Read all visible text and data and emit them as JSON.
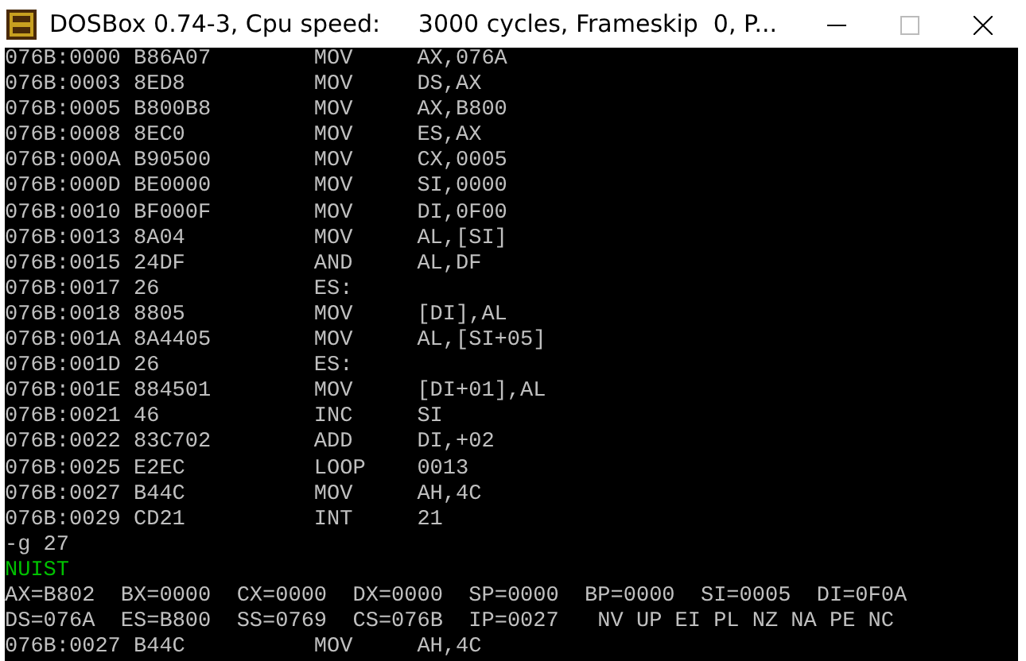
{
  "window": {
    "title": "DOSBox 0.74-3, Cpu speed:     3000 cycles, Frameskip  0, P..."
  },
  "console": {
    "lines": [
      {
        "kind": "asm",
        "address": "076B:0000",
        "bytes": "B86A07",
        "mnemonic": "MOV",
        "operands": "AX,076A"
      },
      {
        "kind": "asm",
        "address": "076B:0003",
        "bytes": "8ED8",
        "mnemonic": "MOV",
        "operands": "DS,AX"
      },
      {
        "kind": "asm",
        "address": "076B:0005",
        "bytes": "B800B8",
        "mnemonic": "MOV",
        "operands": "AX,B800"
      },
      {
        "kind": "asm",
        "address": "076B:0008",
        "bytes": "8EC0",
        "mnemonic": "MOV",
        "operands": "ES,AX"
      },
      {
        "kind": "asm",
        "address": "076B:000A",
        "bytes": "B90500",
        "mnemonic": "MOV",
        "operands": "CX,0005"
      },
      {
        "kind": "asm",
        "address": "076B:000D",
        "bytes": "BE0000",
        "mnemonic": "MOV",
        "operands": "SI,0000"
      },
      {
        "kind": "asm",
        "address": "076B:0010",
        "bytes": "BF000F",
        "mnemonic": "MOV",
        "operands": "DI,0F00"
      },
      {
        "kind": "asm",
        "address": "076B:0013",
        "bytes": "8A04",
        "mnemonic": "MOV",
        "operands": "AL,[SI]"
      },
      {
        "kind": "asm",
        "address": "076B:0015",
        "bytes": "24DF",
        "mnemonic": "AND",
        "operands": "AL,DF"
      },
      {
        "kind": "asm",
        "address": "076B:0017",
        "bytes": "26",
        "mnemonic": "ES:"
      },
      {
        "kind": "asm",
        "address": "076B:0018",
        "bytes": "8805",
        "mnemonic": "MOV",
        "operands": "[DI],AL"
      },
      {
        "kind": "asm",
        "address": "076B:001A",
        "bytes": "8A4405",
        "mnemonic": "MOV",
        "operands": "AL,[SI+05]"
      },
      {
        "kind": "asm",
        "address": "076B:001D",
        "bytes": "26",
        "mnemonic": "ES:"
      },
      {
        "kind": "asm",
        "address": "076B:001E",
        "bytes": "884501",
        "mnemonic": "MOV",
        "operands": "[DI+01],AL"
      },
      {
        "kind": "asm",
        "address": "076B:0021",
        "bytes": "46",
        "mnemonic": "INC",
        "operands": "SI"
      },
      {
        "kind": "asm",
        "address": "076B:0022",
        "bytes": "83C702",
        "mnemonic": "ADD",
        "operands": "DI,+02"
      },
      {
        "kind": "asm",
        "address": "076B:0025",
        "bytes": "E2EC",
        "mnemonic": "LOOP",
        "operands": "0013"
      },
      {
        "kind": "asm",
        "address": "076B:0027",
        "bytes": "B44C",
        "mnemonic": "MOV",
        "operands": "AH,4C"
      },
      {
        "kind": "asm",
        "address": "076B:0029",
        "bytes": "CD21",
        "mnemonic": "INT",
        "operands": "21"
      },
      {
        "kind": "text",
        "text": "-g 27",
        "color": "#c0c0c0"
      },
      {
        "kind": "text",
        "text": "NUIST",
        "color": "#00c000"
      },
      {
        "kind": "text",
        "text": "AX=B802  BX=0000  CX=0000  DX=0000  SP=0000  BP=0000  SI=0005  DI=0F0A",
        "color": "#c0c0c0"
      },
      {
        "kind": "text",
        "text": "DS=076A  ES=B800  SS=0769  CS=076B  IP=0027   NV UP EI PL NZ NA PE NC",
        "color": "#c0c0c0"
      },
      {
        "kind": "asm",
        "address": "076B:0027",
        "bytes": "B44C",
        "mnemonic": "MOV",
        "operands": "AH,4C"
      }
    ]
  }
}
